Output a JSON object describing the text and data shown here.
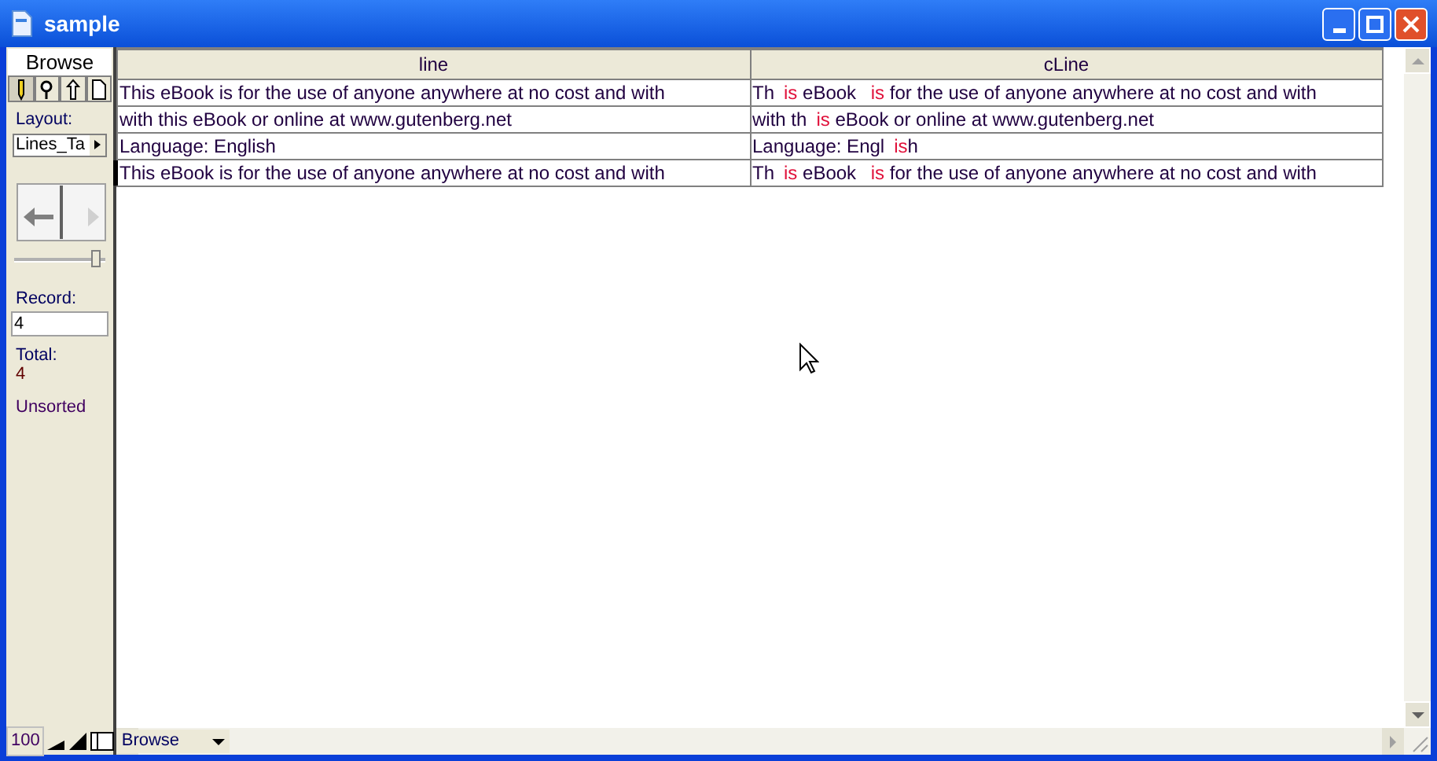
{
  "window": {
    "title": "sample"
  },
  "sidebar": {
    "mode_tab": "Browse",
    "tools": [
      {
        "kind": "pencil",
        "selected": true
      },
      {
        "kind": "magnifier",
        "selected": false
      },
      {
        "kind": "pointer",
        "selected": false
      },
      {
        "kind": "page",
        "selected": false
      }
    ],
    "layout_label": "Layout:",
    "layout_value": "Lines_Ta",
    "slider": {
      "level": 0.95
    },
    "record_label": "Record:",
    "record_value": "4",
    "total_label": "Total:",
    "total_value": "4",
    "sort_status": "Unsorted"
  },
  "table": {
    "columns": [
      "line",
      "cLine"
    ],
    "rows": [
      {
        "selected": false,
        "line": "This eBook is for the use of anyone anywhere at no cost and with",
        "cline": [
          {
            "text": "Th",
            "changed": false
          },
          {
            "text": "is",
            "changed": true
          },
          {
            "text": " eBook ",
            "changed": false
          },
          {
            "text": "is",
            "changed": true
          },
          {
            "text": " for the use of anyone anywhere at no cost and with",
            "changed": false
          }
        ]
      },
      {
        "selected": false,
        "line": "with this eBook or online at www.gutenberg.net",
        "cline": [
          {
            "text": "with th",
            "changed": false
          },
          {
            "text": "is",
            "changed": true
          },
          {
            "text": " eBook or online at www.gutenberg.net",
            "changed": false
          }
        ]
      },
      {
        "selected": false,
        "line": "Language: English",
        "cline": [
          {
            "text": "Language: Engl",
            "changed": false
          },
          {
            "text": "is",
            "changed": true
          },
          {
            "text": "h",
            "changed": false
          }
        ]
      },
      {
        "selected": true,
        "line": "This eBook is for the use of anyone anywhere at no cost and with",
        "cline": [
          {
            "text": "Th",
            "changed": false
          },
          {
            "text": "is",
            "changed": true
          },
          {
            "text": " eBook ",
            "changed": false
          },
          {
            "text": "is",
            "changed": true
          },
          {
            "text": " for the use of anyone anywhere at no cost and with",
            "changed": false
          }
        ]
      }
    ]
  },
  "status_bar": {
    "zoom": "100",
    "mode": "Browse"
  }
}
